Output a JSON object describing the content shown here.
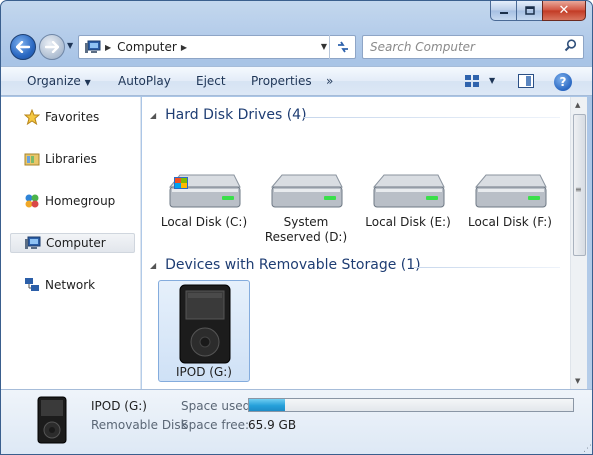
{
  "window": {
    "minimize_icon": "minimize-icon",
    "maximize_icon": "maximize-icon",
    "close_icon": "close-icon",
    "close_glyph": "✕"
  },
  "address_bar": {
    "location": "Computer",
    "search_placeholder": "Search Computer"
  },
  "toolbar": {
    "organize": "Organize",
    "autoplay": "AutoPlay",
    "eject": "Eject",
    "properties": "Properties",
    "more": "»",
    "help": "?"
  },
  "sidebar": {
    "items": [
      {
        "label": "Favorites",
        "icon": "star-icon"
      },
      {
        "label": "Libraries",
        "icon": "libraries-icon"
      },
      {
        "label": "Homegroup",
        "icon": "homegroup-icon"
      },
      {
        "label": "Computer",
        "icon": "computer-icon",
        "selected": true
      },
      {
        "label": "Network",
        "icon": "network-icon"
      }
    ]
  },
  "content": {
    "groups": [
      {
        "title": "Hard Disk Drives (4)",
        "items": [
          {
            "label": "Local Disk (C:)",
            "icon": "system-drive-icon"
          },
          {
            "label": "System Reserved (D:)",
            "icon": "hard-drive-icon"
          },
          {
            "label": "Local Disk (E:)",
            "icon": "hard-drive-icon"
          },
          {
            "label": "Local Disk (F:)",
            "icon": "hard-drive-icon"
          }
        ]
      },
      {
        "title": "Devices with Removable Storage (1)",
        "items": [
          {
            "label": "IPOD (G:)",
            "icon": "ipod-icon",
            "selected": true
          }
        ]
      }
    ]
  },
  "details": {
    "name": "IPOD (G:)",
    "type": "Removable Disk",
    "space_used_label": "Space used:",
    "space_used_fraction": 0.11,
    "space_free_label": "Space free:",
    "space_free_value": "65.9 GB"
  },
  "colors": {
    "group_header": "#1e3d73",
    "selection_bg": "#cfe1f6",
    "usage_fill": "#26a0da"
  }
}
